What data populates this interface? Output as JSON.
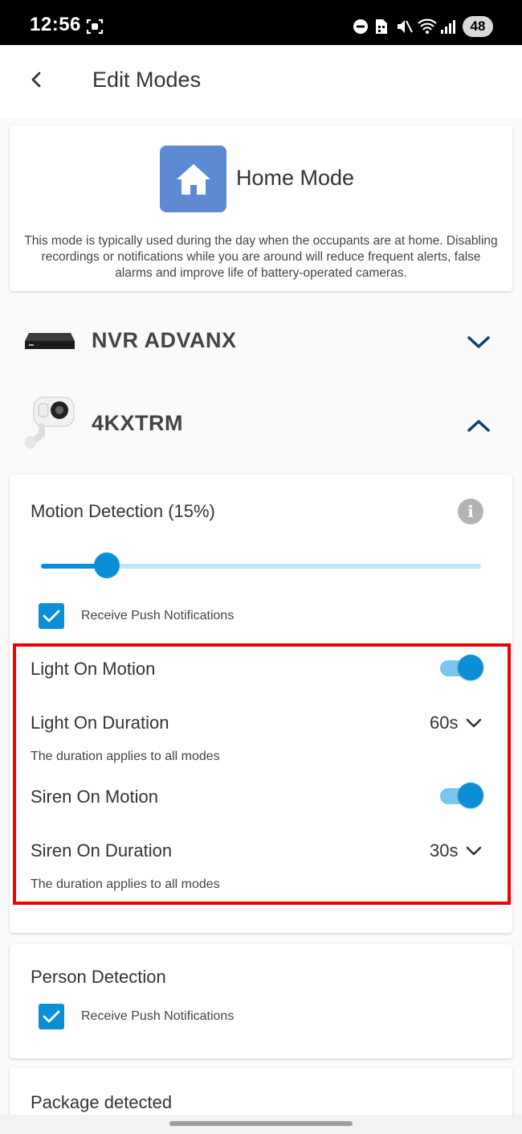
{
  "status_bar": {
    "time": "12:56",
    "battery": "48"
  },
  "header": {
    "title": "Edit Modes"
  },
  "mode": {
    "name": "Home Mode",
    "description": "This mode is typically used during the day when the occupants are at home. Disabling recordings or notifications while you are around will reduce frequent alerts, false alarms and improve life of battery-operated cameras."
  },
  "devices": [
    {
      "name": "NVR ADVANX",
      "expanded": false
    },
    {
      "name": "4KXTRM",
      "expanded": true
    }
  ],
  "motion_detection": {
    "label": "Motion Detection (15%)",
    "sensitivity_percent": 15,
    "push_label": "Receive Push Notifications",
    "push_checked": true,
    "light_on_motion_label": "Light On Motion",
    "light_on_motion_on": true,
    "light_on_duration_label": "Light On Duration",
    "light_on_duration_value": "60s",
    "light_duration_note": "The duration applies to all modes",
    "siren_on_motion_label": "Siren On Motion",
    "siren_on_motion_on": true,
    "siren_on_duration_label": "Siren On Duration",
    "siren_on_duration_value": "30s",
    "siren_duration_note": "The duration applies to all modes"
  },
  "person_detection": {
    "label": "Person Detection",
    "push_label": "Receive Push Notifications",
    "push_checked": true
  },
  "package_detection": {
    "label": "Package detected"
  },
  "colors": {
    "accent": "#0a8fd6",
    "toggle_track": "#7cc6ec",
    "mode_icon_bg": "#5d8ad1",
    "highlight": "#ee0000"
  }
}
